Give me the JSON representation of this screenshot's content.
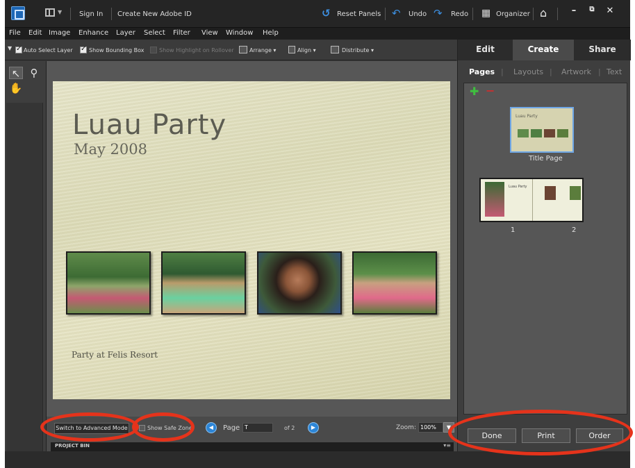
{
  "titlebar": {
    "sign_in": "Sign In",
    "create_id": "Create New Adobe ID",
    "reset_panels": "Reset Panels",
    "undo": "Undo",
    "redo": "Redo",
    "organizer": "Organizer"
  },
  "menu": [
    "File",
    "Edit",
    "Image",
    "Enhance",
    "Layer",
    "Select",
    "Filter",
    "View",
    "Window",
    "Help"
  ],
  "options": {
    "auto_select": "Auto Select Layer",
    "bounding_box": "Show Bounding Box",
    "highlight": "Show Highlight on Rollover",
    "arrange": "Arrange",
    "align": "Align",
    "distribute": "Distribute"
  },
  "document": {
    "title": "Luau Party",
    "subtitle": "May  2008",
    "caption": "Party at Felis Resort"
  },
  "bottom": {
    "advanced_mode": "Switch to Advanced Mode",
    "safe_zone": "Show Safe Zone",
    "page_label": "Page",
    "page_value": "T",
    "of_label": "of 2",
    "zoom_label": "Zoom:",
    "zoom_value": "100%",
    "project_bin": "PROJECT BIN"
  },
  "right_panel": {
    "mode_tabs": [
      "Edit",
      "Create",
      "Share"
    ],
    "sub_tabs": [
      "Pages",
      "Layouts",
      "Artwork",
      "Text"
    ],
    "title_page_label": "Title Page",
    "thumb_title_text": "Luau Party",
    "spread_left_text": "Luau Party",
    "page_numbers": [
      "1",
      "2"
    ],
    "buttons": [
      "Done",
      "Print",
      "Order"
    ]
  },
  "colors": {
    "annotation": "#e5331b",
    "selection": "#6fa7e6",
    "nav_blue": "#2d86d7"
  }
}
